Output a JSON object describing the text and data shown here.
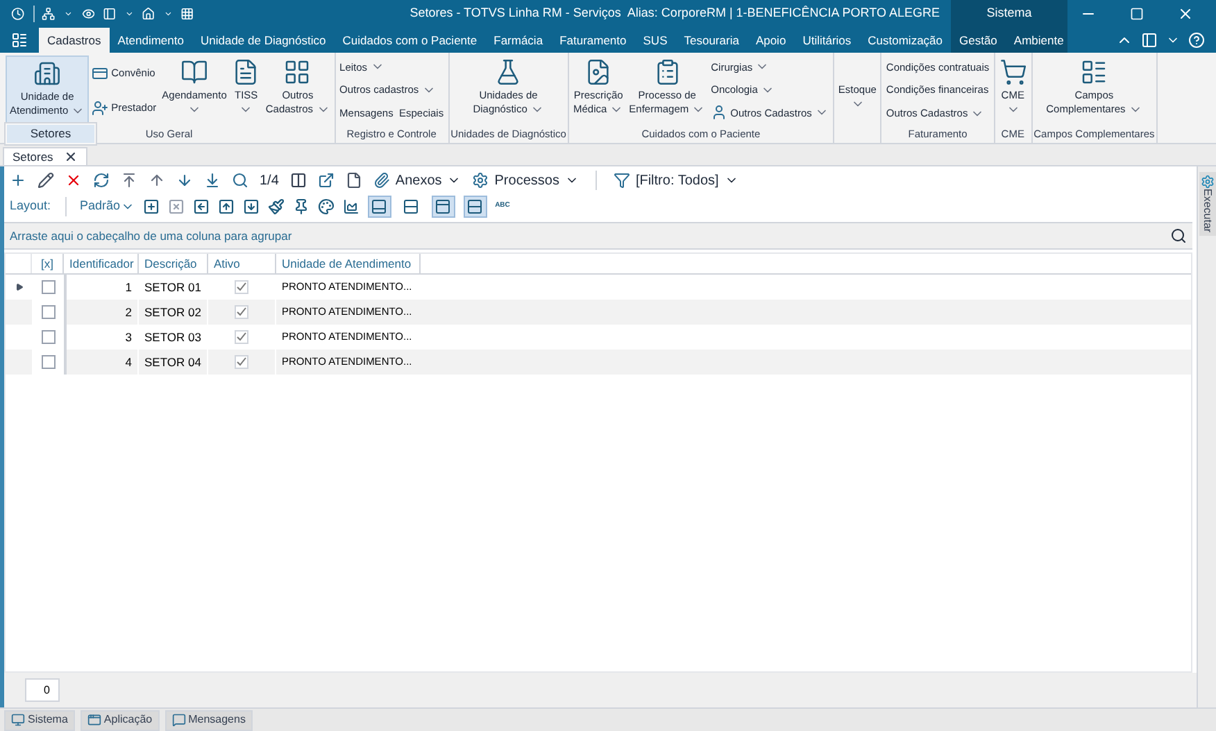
{
  "title_bar": {
    "title": "Setores - TOTVS Linha RM - Serviços  Alias: CorporeRM | 1-BENEFICÊNCIA PORTO ALEGRE",
    "system_label": "Sistema"
  },
  "menu_tabs": [
    {
      "label": "Cadastros",
      "kind": "app",
      "selected": true
    },
    {
      "label": "Atendimento",
      "kind": "app",
      "selected": false
    },
    {
      "label": "Unidade de Diagnóstico",
      "kind": "app",
      "selected": false
    },
    {
      "label": "Cuidados com o Paciente",
      "kind": "app",
      "selected": false
    },
    {
      "label": "Farmácia",
      "kind": "app",
      "selected": false
    },
    {
      "label": "Faturamento",
      "kind": "app",
      "selected": false
    },
    {
      "label": "SUS",
      "kind": "app",
      "selected": false
    },
    {
      "label": "Tesouraria",
      "kind": "app",
      "selected": false
    },
    {
      "label": "Apoio",
      "kind": "app",
      "selected": false
    },
    {
      "label": "Utilitários",
      "kind": "app",
      "selected": false
    },
    {
      "label": "Customização",
      "kind": "app",
      "selected": false
    },
    {
      "label": "Gestão",
      "kind": "system",
      "selected": false
    },
    {
      "label": "Ambiente",
      "kind": "system",
      "selected": false
    }
  ],
  "ribbon_groups": [
    {
      "label": "Uso Geral",
      "columns": [
        {
          "kind": "large",
          "lines": [
            "Unidade de",
            "Atendimento"
          ],
          "dropdown": true,
          "open": true
        },
        {
          "kind": "stack",
          "items": [
            {
              "label": "Convênio",
              "dropdown": false
            },
            {
              "label": "Prestador",
              "dropdown": false
            }
          ]
        },
        {
          "kind": "large",
          "lines": [
            "Agendamento"
          ],
          "dropdown": true,
          "open": false
        },
        {
          "kind": "large",
          "lines": [
            "TISS"
          ],
          "dropdown": true,
          "open": false
        },
        {
          "kind": "large",
          "lines": [
            "Outros",
            "Cadastros"
          ],
          "dropdown": true,
          "open": false
        }
      ]
    },
    {
      "label": "Registro e Controle",
      "columns": [
        {
          "kind": "stack",
          "items": [
            {
              "label": "Leitos",
              "dropdown": true
            },
            {
              "label": "Outros cadastros",
              "dropdown": true
            },
            {
              "label": "Mensagens  Especiais",
              "dropdown": false
            }
          ]
        }
      ]
    },
    {
      "label": "Unidades de Diagnóstico",
      "columns": [
        {
          "kind": "large",
          "lines": [
            "Unidades de",
            "Diagnóstico"
          ],
          "dropdown": true,
          "open": false
        }
      ]
    },
    {
      "label": "Cuidados com o Paciente",
      "columns": [
        {
          "kind": "large",
          "lines": [
            "Prescrição",
            "Médica"
          ],
          "dropdown": true,
          "open": false
        },
        {
          "kind": "large",
          "lines": [
            "Processo de",
            "Enfermagem"
          ],
          "dropdown": true,
          "open": false
        },
        {
          "kind": "stack",
          "items": [
            {
              "label": "Cirurgias",
              "dropdown": true
            },
            {
              "label": "Oncologia",
              "dropdown": true
            },
            {
              "label": "Outros Cadastros",
              "dropdown": true
            }
          ]
        }
      ]
    },
    {
      "columns": [
        {
          "kind": "text",
          "lines": [
            "Estoque"
          ],
          "dropdown": true,
          "open": false
        }
      ]
    },
    {
      "label": "Faturamento",
      "columns": [
        {
          "kind": "stack",
          "items": [
            {
              "label": "Condições contratuais",
              "dropdown": false
            },
            {
              "label": "Condições financeiras",
              "dropdown": false
            },
            {
              "label": "Outros Cadastros",
              "dropdown": true
            }
          ]
        }
      ]
    },
    {
      "label": "CME",
      "columns": [
        {
          "kind": "large",
          "lines": [
            "CME"
          ],
          "dropdown": true,
          "open": false
        }
      ]
    },
    {
      "label": "Campos Complementares",
      "columns": [
        {
          "kind": "large",
          "lines": [
            "Campos",
            "Complementares"
          ],
          "dropdown": true,
          "open": false
        }
      ]
    }
  ],
  "dropdown_menu": {
    "items": [
      "Setores"
    ]
  },
  "document_tabs": [
    {
      "label": "Setores",
      "selected": true
    }
  ],
  "toolbar": {
    "record_position": "1/4",
    "attachments": "Anexos",
    "processes": "Processos",
    "filter": "[Filtro: Todos]"
  },
  "layout_bar": {
    "label": "Layout:",
    "value": "Padrão",
    "toggles": [
      {
        "selected": true
      },
      {
        "selected": false
      },
      {
        "selected": true
      },
      {
        "selected": true
      }
    ],
    "abc": "ABC"
  },
  "group_panel": {
    "hint": "Arraste aqui o cabeçalho de uma coluna para agrupar"
  },
  "table": {
    "columns": [
      "[x]",
      "Identificador",
      "Descrição",
      "Ativo",
      "Unidade de Atendimento"
    ],
    "rows": [
      {
        "selected": true,
        "checked": false,
        "id": "1",
        "description": "SETOR 01",
        "active": true,
        "unit": "PRONTO ATENDIMENTO..."
      },
      {
        "selected": false,
        "checked": false,
        "id": "2",
        "description": "SETOR 02",
        "active": true,
        "unit": "PRONTO ATENDIMENTO..."
      },
      {
        "selected": false,
        "checked": false,
        "id": "3",
        "description": "SETOR 03",
        "active": true,
        "unit": "PRONTO ATENDIMENTO..."
      },
      {
        "selected": false,
        "checked": false,
        "id": "4",
        "description": "SETOR 04",
        "active": true,
        "unit": "PRONTO ATENDIMENTO..."
      }
    ]
  },
  "footer": {
    "count": "0"
  },
  "side_panel": {
    "label": "Executar"
  },
  "status_tabs": [
    "Sistema",
    "Aplicação",
    "Mensagens"
  ]
}
